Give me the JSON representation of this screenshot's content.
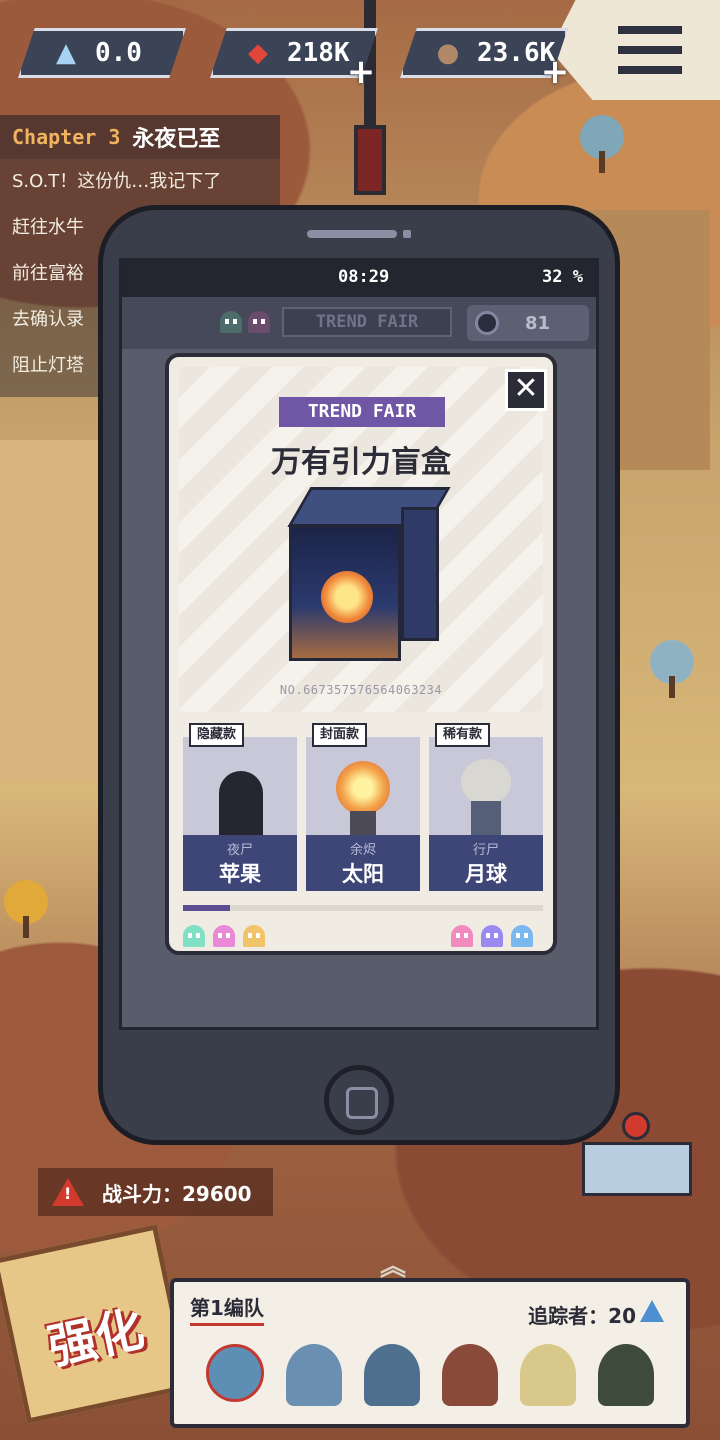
{
  "hud": {
    "pyramid_value": "0.0",
    "gem_value": "218K",
    "ore_value": "23.6K",
    "plus": "+"
  },
  "quest": {
    "chapter_label": "Chapter 3",
    "chapter_title": "永夜已至",
    "items": [
      "S.O.T！这份仇…我记下了",
      "赶往水牛",
      "前往富裕",
      "去确认录",
      "阻止灯塔"
    ]
  },
  "phone": {
    "time": "08:29",
    "battery": "32 %",
    "app_logo": "TREND FAIR",
    "coins": "81"
  },
  "card": {
    "close_symbol": "✕",
    "badge": "TREND FAIR",
    "title": "万有引力盲盒",
    "serial": "NO.667357576564063234",
    "variants": [
      {
        "tag": "隐藏款",
        "sub": "夜尸",
        "name": "苹果"
      },
      {
        "tag": "封面款",
        "sub": "余烬",
        "name": "太阳"
      },
      {
        "tag": "稀有款",
        "sub": "行尸",
        "name": "月球"
      }
    ],
    "progress": 0.13,
    "ghost_colors_left": [
      "#7fe0c4",
      "#e88ad8",
      "#f2c46a"
    ],
    "ghost_colors_right": [
      "#f08abf",
      "#9a8af0",
      "#7ab8f0"
    ]
  },
  "bottom": {
    "power_label": "战斗力：29600",
    "strengthen": "强化",
    "team_name": "第1编队",
    "tracker_label": "追踪者：20",
    "chevron": "︽"
  },
  "colors": {
    "accent_purple": "#6f57a5",
    "danger_red": "#d23a2e",
    "panel_dark": "#2b2c37"
  }
}
